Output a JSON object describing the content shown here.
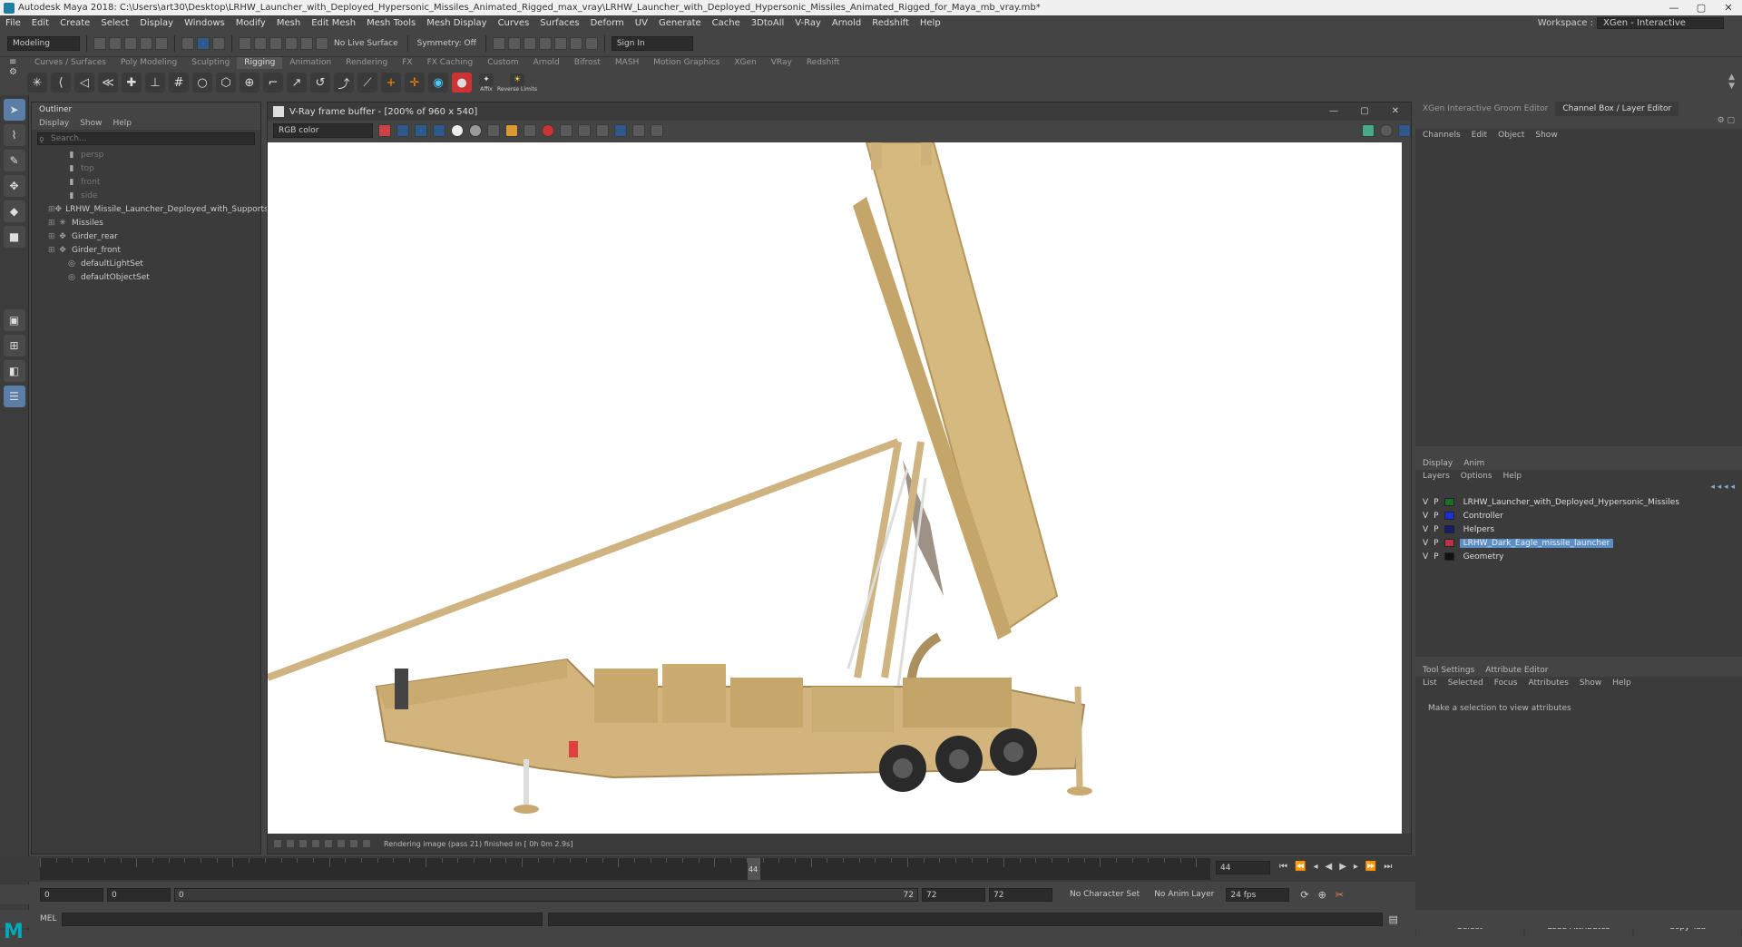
{
  "title_bar": {
    "text": "Autodesk Maya 2018: C:\\Users\\art30\\Desktop\\LRHW_Launcher_with_Deployed_Hypersonic_Missiles_Animated_Rigged_max_vray\\LRHW_Launcher_with_Deployed_Hypersonic_Missiles_Animated_Rigged_for_Maya_mb_vray.mb*"
  },
  "menu": [
    "File",
    "Edit",
    "Create",
    "Select",
    "Display",
    "Windows",
    "Modify",
    "Mesh",
    "Edit Mesh",
    "Mesh Tools",
    "Mesh Display",
    "Curves",
    "Surfaces",
    "Deform",
    "UV",
    "Generate",
    "Cache",
    "3DtoAll",
    "V-Ray",
    "Arnold",
    "Redshift",
    "Help"
  ],
  "workspace": {
    "label": "Workspace :",
    "value": "XGen - Interactive Groom"
  },
  "status_line": {
    "mode": "Modeling",
    "no_live_surface": "No Live Surface",
    "symmetry": "Symmetry: Off",
    "sign_in": "Sign In"
  },
  "shelf_tabs": [
    "Curves / Surfaces",
    "Poly Modeling",
    "Sculpting",
    "Rigging",
    "Animation",
    "Rendering",
    "FX",
    "FX Caching",
    "Custom",
    "Arnold",
    "Bifrost",
    "MASH",
    "Motion Graphics",
    "XGen",
    "VRay",
    "Redshift"
  ],
  "shelf_active": "Rigging",
  "shelf_labels": {
    "affix": "Affix",
    "reverse": "Reverse Limits"
  },
  "outliner": {
    "title": "Outliner",
    "menu": [
      "Display",
      "Show",
      "Help"
    ],
    "search_placeholder": "Search...",
    "items": [
      {
        "label": "persp",
        "dim": true,
        "icon": "camera-icon",
        "indent": 1
      },
      {
        "label": "top",
        "dim": true,
        "icon": "camera-icon",
        "indent": 1
      },
      {
        "label": "front",
        "dim": true,
        "icon": "camera-icon",
        "indent": 1
      },
      {
        "label": "side",
        "dim": true,
        "icon": "camera-icon",
        "indent": 1
      },
      {
        "label": "LRHW_Missile_Launcher_Deployed_with_Supports_(",
        "dim": false,
        "icon": "transform-icon",
        "indent": 0
      },
      {
        "label": "Missiles",
        "dim": false,
        "icon": "joint-icon",
        "indent": 0
      },
      {
        "label": "Girder_rear",
        "dim": false,
        "icon": "transform-icon",
        "indent": 0
      },
      {
        "label": "Girder_front",
        "dim": false,
        "icon": "transform-icon",
        "indent": 0
      },
      {
        "label": "defaultLightSet",
        "dim": false,
        "icon": "set-icon",
        "indent": 1
      },
      {
        "label": "defaultObjectSet",
        "dim": false,
        "icon": "set-icon",
        "indent": 1
      }
    ]
  },
  "vray": {
    "title": "V-Ray frame buffer - [200% of 960 x 540]",
    "channel": "RGB color",
    "status": "Rendering image (pass 21) finished in [ 0h 0m 2.9s]"
  },
  "right_panel": {
    "tabs": [
      "XGen Interactive Groom Editor",
      "Channel Box / Layer Editor"
    ],
    "active_tab": "Channel Box / Layer Editor",
    "channel_menu": [
      "Channels",
      "Edit",
      "Object",
      "Show"
    ],
    "layer_tabs": [
      "Display",
      "Anim"
    ],
    "layer_menu": [
      "Layers",
      "Options",
      "Help"
    ],
    "layers": [
      {
        "name": "LRHW_Launcher_with_Deployed_Hypersonic_Missiles",
        "color": "#1a6e2a",
        "selected": false
      },
      {
        "name": "Controller",
        "color": "#1a2ee0",
        "selected": false
      },
      {
        "name": "Helpers",
        "color": "#181a6a",
        "selected": false
      },
      {
        "name": "LRHW_Dark_Eagle_missile_launcher",
        "color": "#c0304a",
        "selected": true
      },
      {
        "name": "Geometry",
        "color": "#111111",
        "selected": false
      }
    ],
    "attr_tabs": [
      "Tool Settings",
      "Attribute Editor"
    ],
    "attr_menu": [
      "List",
      "Selected",
      "Focus",
      "Attributes",
      "Show",
      "Help"
    ],
    "attr_message": "Make a selection to view attributes",
    "attr_buttons": [
      "Select",
      "Load Attributes",
      "Copy Tab"
    ]
  },
  "timeline": {
    "current_frame": "44",
    "marker_frame": "44"
  },
  "range": {
    "start": "0",
    "start2": "0",
    "anim_start": "0",
    "end_marker": "72",
    "end": "72",
    "end2": "72",
    "char_set": "No Character Set",
    "anim_layer": "No Anim Layer",
    "fps": "24 fps"
  },
  "mel": {
    "label": "MEL"
  }
}
